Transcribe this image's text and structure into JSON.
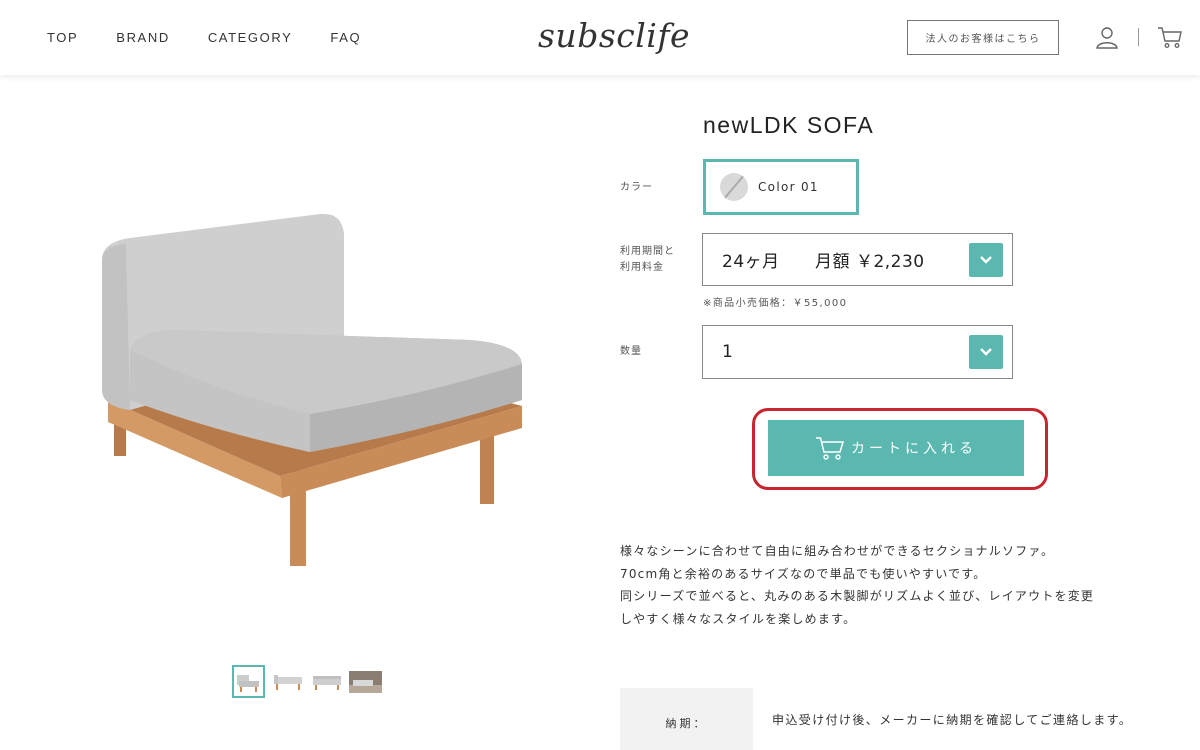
{
  "header": {
    "nav": [
      "TOP",
      "BRAND",
      "CATEGORY",
      "FAQ"
    ],
    "logo": "subsclife",
    "corporate_button": "法人のお客様はこちら",
    "icons": [
      "user-icon",
      "cart-icon"
    ]
  },
  "product": {
    "title": "newLDK SOFA",
    "color_label": "カラー",
    "color_value": "Color 01",
    "period_label_line1": "利用期間と",
    "period_label_line2": "利用料金",
    "period_value": "24ヶ月      月額 ￥2,230",
    "retail_note": "※商品小売価格：￥55,000",
    "quantity_label": "数量",
    "quantity_value": "1",
    "add_to_cart": "カートに入れる",
    "description": [
      "様々なシーンに合わせて自由に組み合わせができるセクショナルソファ。",
      "70cm角と余裕のあるサイズなので単品でも使いやすいです。",
      "同シリーズで並べると、丸みのある木製脚がリズムよく並び、レイアウトを変更",
      "しやすく様々なスタイルを楽しめます。"
    ],
    "delivery_label": "納期：",
    "delivery_text": "申込受け付け後、メーカーに納期を確認してご連絡します。"
  },
  "colors": {
    "accent": "#5bb8b0",
    "highlight": "#c7262f"
  }
}
